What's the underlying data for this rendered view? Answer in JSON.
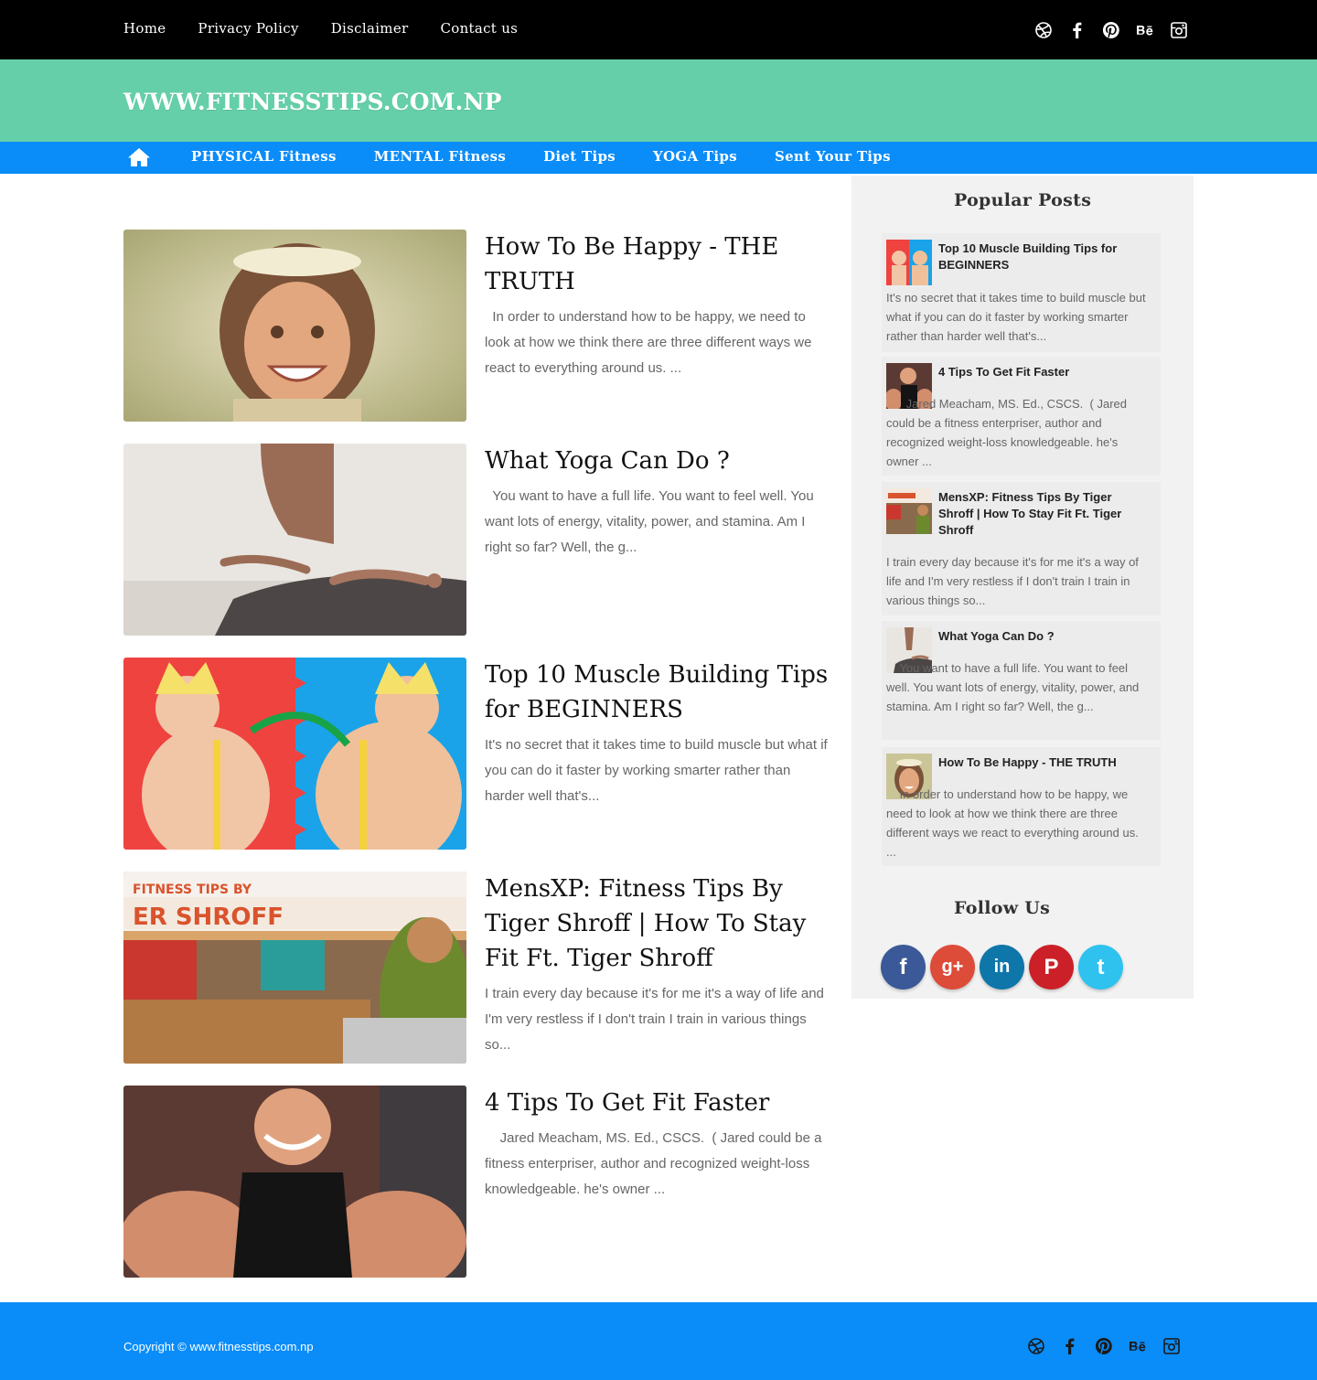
{
  "top_nav": [
    "Home",
    "Privacy Policy",
    "Disclaimer",
    "Contact us"
  ],
  "social_icons": [
    "dribbble-icon",
    "facebook-icon",
    "pinterest-icon",
    "behance-icon",
    "instagram-icon"
  ],
  "site_title": "WWW.FITNESSTIPS.COM.NP",
  "main_nav": {
    "home_icon": "home-icon",
    "items": [
      "PHYSICAL Fitness",
      "MENTAL Fitness",
      "Diet Tips",
      "YOGA Tips",
      "Sent Your Tips"
    ]
  },
  "posts": [
    {
      "title": "How To Be Happy - THE TRUTH",
      "excerpt": "  In order to understand how to be happy, we need to look at how we think there are three different ways we react to everything around us. ..."
    },
    {
      "title": "What Yoga Can Do ?",
      "excerpt": "  You want to have a full life. You want to feel well. You want lots of energy, vitality, power, and stamina. Am I right so far? Well, the g..."
    },
    {
      "title": "Top 10 Muscle Building Tips for BEGINNERS",
      "excerpt": "It's no secret that it takes time to build muscle but what if you can do it faster by working smarter rather than harder well that's..."
    },
    {
      "title": "MensXP: Fitness Tips By Tiger Shroff | How To Stay Fit Ft. Tiger Shroff",
      "excerpt": "I train every day because it's for me it's a way of life and I'm very restless if I don't train I train in various things so..."
    },
    {
      "title": "4 Tips To Get Fit Faster",
      "excerpt": "    Jared Meacham, MS. Ed., CSCS.  ( Jared could be a fitness enterpriser, author and recognized weight-loss knowledgeable. he's owner ..."
    }
  ],
  "sidebar": {
    "popular_heading": "Popular Posts",
    "popular": [
      {
        "title": "Top 10 Muscle Building Tips for BEGINNERS",
        "excerpt": "It's no secret that it takes time to build muscle but what if you can do it faster by working smarter rather than harder well that's..."
      },
      {
        "title": "4 Tips To Get Fit Faster",
        "excerpt": "      Jared Meacham, MS. Ed., CSCS.  ( Jared could be a fitness enterpriser, author and recognized weight-loss knowledgeable. he's owner ..."
      },
      {
        "title": "MensXP: Fitness Tips By Tiger Shroff | How To Stay Fit Ft. Tiger Shroff",
        "excerpt": "I train every day because it's for me it's a way of life and I'm very restless if I don't train I train in various things so..."
      },
      {
        "title": "What Yoga Can Do ?",
        "excerpt": "    You want to have a full life. You want to feel well. You want lots of energy, vitality, power, and stamina. Am I right so far? Well, the g..."
      },
      {
        "title": "How To Be Happy - THE TRUTH",
        "excerpt": "    In order to understand how to be happy, we need to look at how we think there are three different ways we react to everything around us. ..."
      }
    ],
    "follow_heading": "Follow Us",
    "follow": [
      {
        "icon": "facebook-icon",
        "glyph": "f",
        "color": "#3b5998"
      },
      {
        "icon": "google-plus-icon",
        "glyph": "g+",
        "color": "#dd4b39"
      },
      {
        "icon": "linkedin-icon",
        "glyph": "in",
        "color": "#0e76a8"
      },
      {
        "icon": "pinterest-icon",
        "glyph": "P",
        "color": "#cb2027"
      },
      {
        "icon": "twitter-icon",
        "glyph": "t",
        "color": "#2fc2ef"
      }
    ]
  },
  "footer": {
    "copyright": "Copyright © www.fitnesstips.com.np"
  },
  "colors": {
    "top_bar": "#000000",
    "header": "#64cfa9",
    "nav": "#0a8cf9",
    "sidebar": "#f2f2f2",
    "footer": "#0a8cf9"
  }
}
